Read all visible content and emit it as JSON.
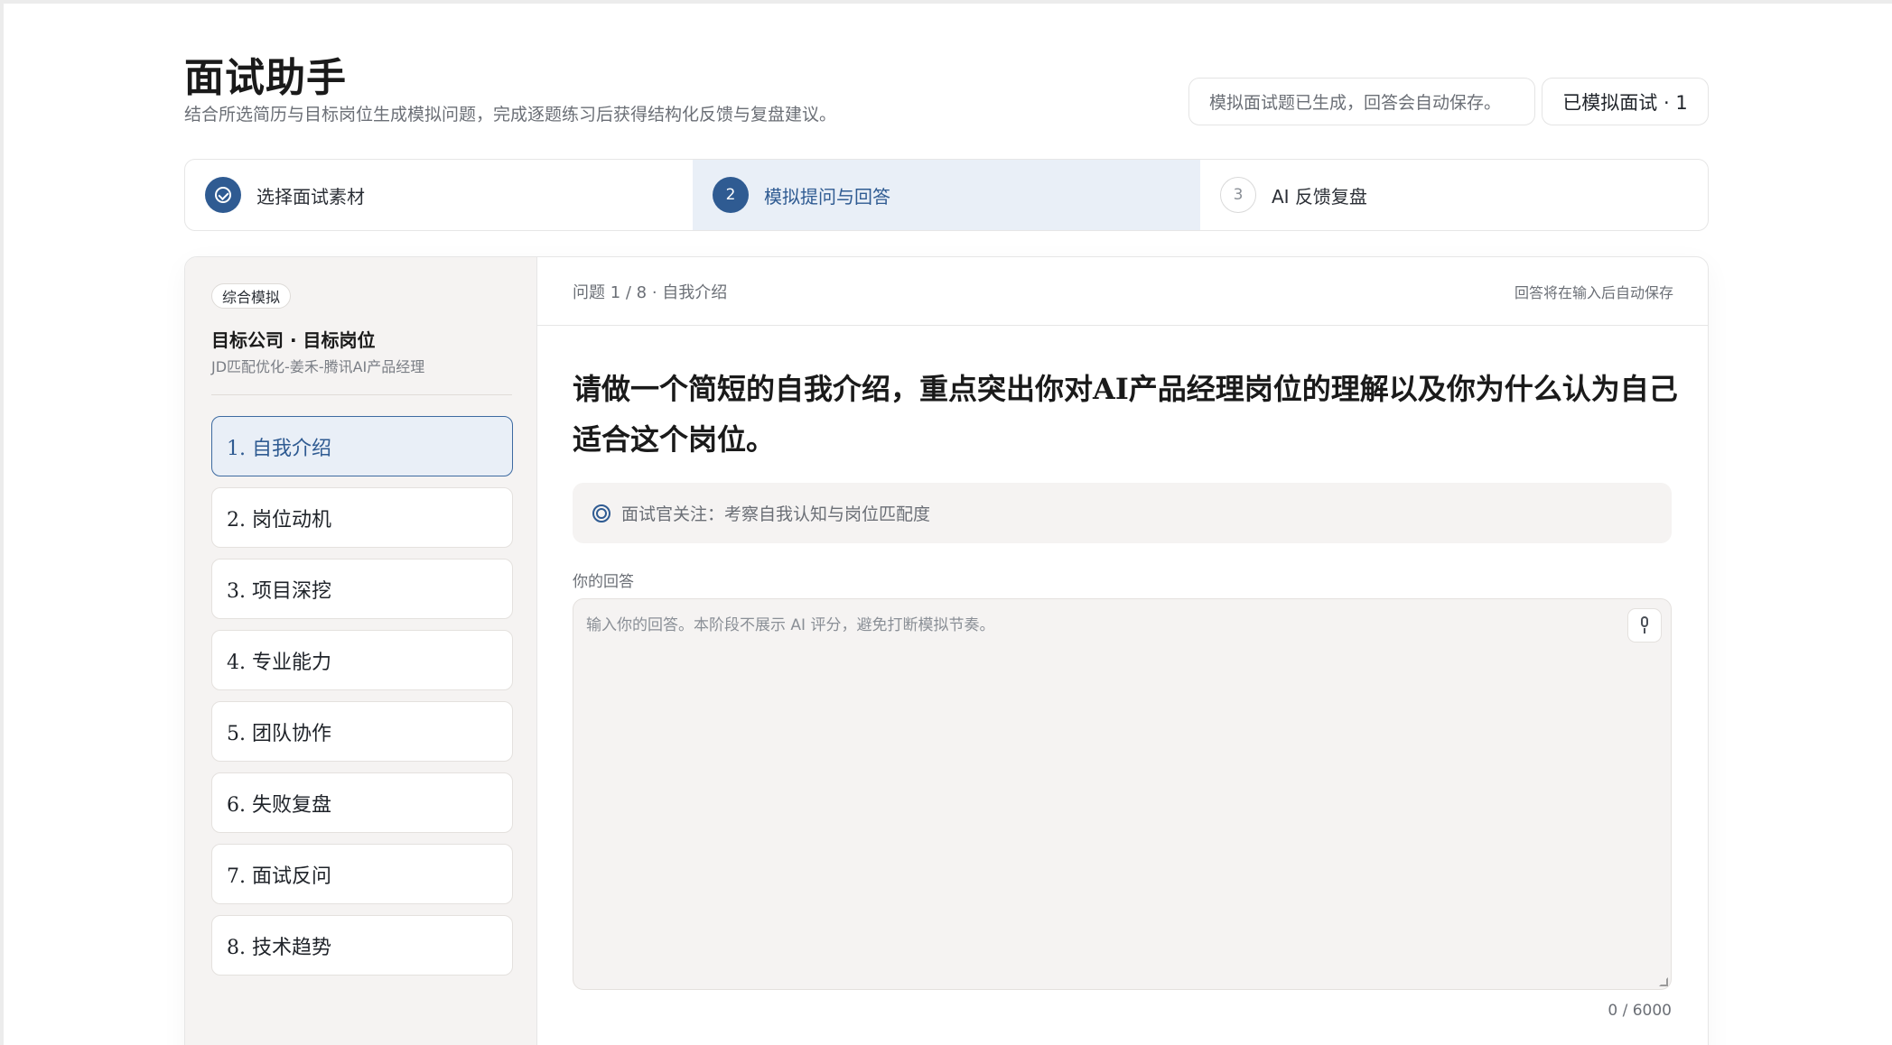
{
  "header": {
    "title": "面试助手",
    "subtitle": "结合所选简历与目标岗位生成模拟问题，完成逐题练习后获得结构化反馈与复盘建议。",
    "status": "模拟面试题已生成，回答会自动保存。",
    "count_button": "已模拟面试 · 1"
  },
  "stepper": [
    {
      "number": "",
      "label": "选择面试素材",
      "state": "done"
    },
    {
      "number": "2",
      "label": "模拟提问与回答",
      "state": "current"
    },
    {
      "number": "3",
      "label": "AI 反馈复盘",
      "state": "pending"
    }
  ],
  "sidebar": {
    "mode_tag": "综合模拟",
    "target_title": "目标公司 · 目标岗位",
    "target_sub": "JD匹配优化-姜禾-腾讯AI产品经理",
    "questions": [
      "1. 自我介绍",
      "2. 岗位动机",
      "3. 项目深挖",
      "4. 专业能力",
      "5. 团队协作",
      "6. 失败复盘",
      "7. 面试反问",
      "8. 技术趋势"
    ],
    "active_index": 0
  },
  "main": {
    "progress": "问题 1 / 8 · 自我介绍",
    "autosave_note": "回答将在输入后自动保存",
    "question": "请做一个简短的自我介绍，重点突出你对AI产品经理岗位的理解以及你为什么认为自己适合这个岗位。",
    "focus_text": "面试官关注：考察自我认知与岗位匹配度",
    "answer_label": "你的回答",
    "answer_placeholder": "输入你的回答。本阶段不展示 AI 评分，避免打断模拟节奏。",
    "answer_value": "",
    "char_count": "0 / 6000"
  },
  "icons": {
    "step_done": "check-circle-icon",
    "focus": "target-icon",
    "mic": "microphone-icon"
  },
  "colors": {
    "accent": "#2f5b92",
    "active_bg": "#e9eff7",
    "sidebar_bg": "#f5f3f2"
  }
}
